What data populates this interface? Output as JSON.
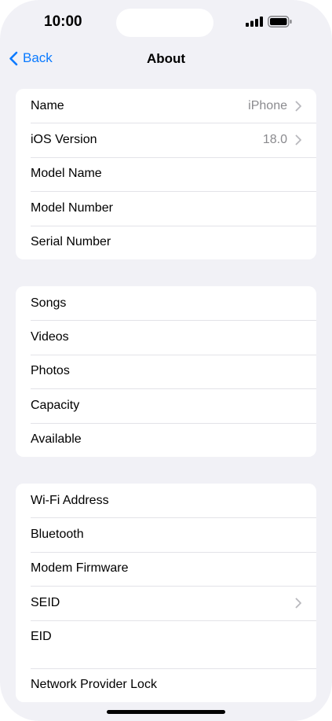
{
  "status": {
    "time": "10:00"
  },
  "nav": {
    "back_label": "Back",
    "title": "About"
  },
  "groups": [
    {
      "rows": [
        {
          "label": "Name",
          "value": "iPhone",
          "chevron": true
        },
        {
          "label": "iOS Version",
          "value": "18.0",
          "chevron": true
        },
        {
          "label": "Model Name",
          "value": "",
          "chevron": false
        },
        {
          "label": "Model Number",
          "value": "",
          "chevron": false
        },
        {
          "label": "Serial Number",
          "value": "",
          "chevron": false
        }
      ]
    },
    {
      "rows": [
        {
          "label": "Songs",
          "value": "",
          "chevron": false
        },
        {
          "label": "Videos",
          "value": "",
          "chevron": false
        },
        {
          "label": "Photos",
          "value": "",
          "chevron": false
        },
        {
          "label": "Capacity",
          "value": "",
          "chevron": false
        },
        {
          "label": "Available",
          "value": "",
          "chevron": false
        }
      ]
    },
    {
      "rows": [
        {
          "label": "Wi-Fi Address",
          "value": "",
          "chevron": false
        },
        {
          "label": "Bluetooth",
          "value": "",
          "chevron": false
        },
        {
          "label": "Modem Firmware",
          "value": "",
          "chevron": false
        },
        {
          "label": "SEID",
          "value": "",
          "chevron": true
        },
        {
          "label": "EID",
          "value": "",
          "chevron": false
        },
        {
          "label": "Network Provider Lock",
          "value": "",
          "chevron": false
        }
      ]
    }
  ],
  "icons": {
    "back": "chevron-left-icon",
    "row_disclosure": "chevron-right-icon",
    "signal": "cellular-signal-icon",
    "battery": "battery-icon"
  },
  "colors": {
    "accent": "#0a7aff",
    "background": "#f1f1f6",
    "secondary_text": "#8a8a8e"
  }
}
